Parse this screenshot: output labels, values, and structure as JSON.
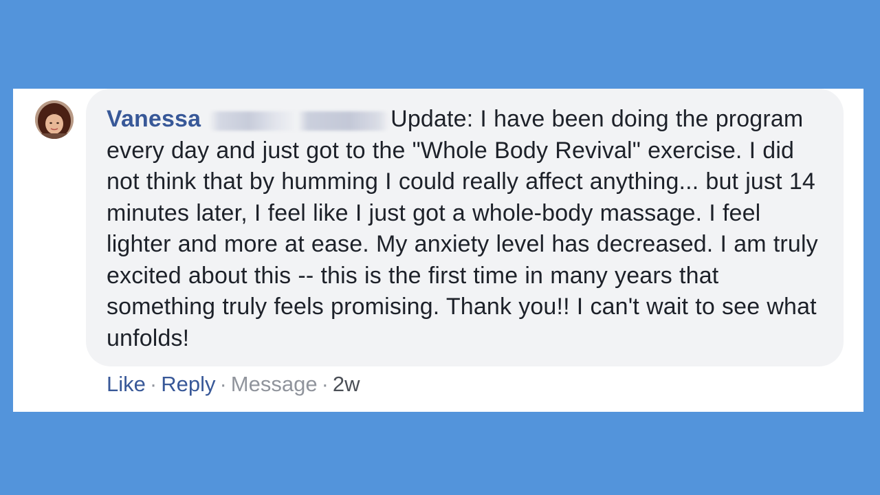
{
  "comment": {
    "author_first_name": "Vanessa",
    "body": "Update: I have been doing the program every day and just got to the \"Whole Body Revival\" exercise. I did not think that by humming I could really affect anything... but just 14 minutes later, I feel like I just got a whole-body massage. I feel lighter and more at ease. My anxiety level has decreased. I am truly excited about this -- this is the first time in many years that something truly feels promising. Thank you!! I can't wait to see what unfolds!"
  },
  "actions": {
    "like": "Like",
    "reply": "Reply",
    "message": "Message",
    "separator": "·",
    "timestamp": "2w"
  },
  "colors": {
    "background": "#5394db",
    "card": "#ffffff",
    "bubble": "#f2f3f5",
    "author_link": "#385898",
    "body_text": "#1d2129",
    "muted": "#90949c"
  }
}
